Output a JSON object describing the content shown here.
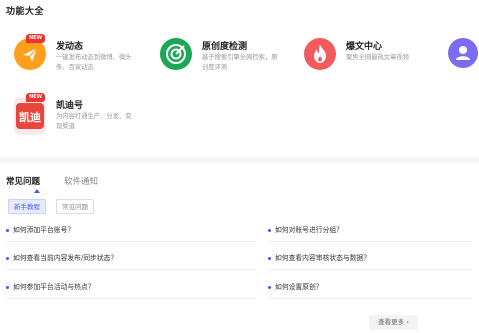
{
  "section_title": "功能大全",
  "badge": "NEW",
  "features": [
    {
      "name": "发动态",
      "desc": "一键发布动态到微博、微头条、百家动态"
    },
    {
      "name": "原创度检测",
      "desc": "基于搜索引擎全网检索，原创度评测"
    },
    {
      "name": "爆文中心",
      "desc": "聚焦全网最热文章视频"
    },
    {
      "name": "凯迪号",
      "desc": "为内容打通生产、分发、变现渠道"
    }
  ],
  "kaidi_logo_text": "凯迪",
  "tabs": [
    {
      "label": "常见问题"
    },
    {
      "label": "软件通知"
    }
  ],
  "chips": [
    {
      "label": "新手教程"
    },
    {
      "label": "常见问题"
    }
  ],
  "questions": [
    "如何添加平台账号？",
    "如何对账号进行分组？",
    "如何查看当前内容发布/同步状态？",
    "如何查看内容审核状态与数据？",
    "如何参加平台活动与热点？",
    "如何设置原创？"
  ],
  "more_label": "查看更多 ›",
  "colors": {
    "accent": "#3d5afe",
    "publish": "#ff9f1c",
    "original": "#1aa853",
    "hot": "#f25b5b",
    "user": "#7b6cf0",
    "new_badge": "#f0342d"
  },
  "icons": [
    "send-icon",
    "target-icon",
    "flame-icon",
    "user-icon"
  ]
}
